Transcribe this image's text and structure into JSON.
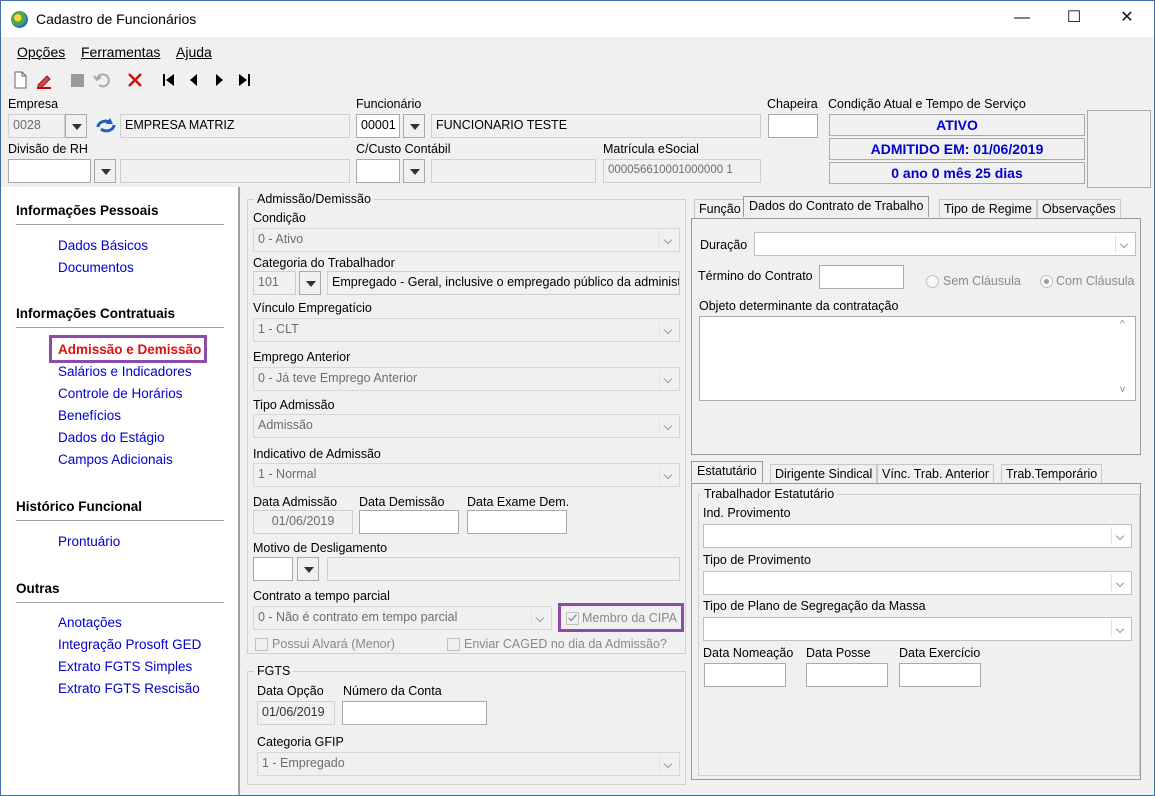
{
  "window": {
    "title": "Cadastro de Funcionários",
    "min": "—",
    "max": "☐",
    "close": "✕"
  },
  "menu": [
    "Opções",
    "Ferramentas",
    "Ajuda"
  ],
  "header": {
    "empresa_label": "Empresa",
    "empresa_code": "0028",
    "empresa_name": "EMPRESA MATRIZ",
    "funcionario_label": "Funcionário",
    "funcionario_code": "00001",
    "funcionario_name": "FUNCIONARIO TESTE",
    "chapeira_label": "Chapeira",
    "chapeira_value": "",
    "condicao_label": "Condição Atual e Tempo de Serviço",
    "status_ativo": "ATIVO",
    "status_admitido": "ADMITIDO EM: 01/06/2019",
    "status_tempo": "0 ano 0 mês 25 dias",
    "divisao_label": "Divisão de RH",
    "ccusto_label": "C/Custo Contábil",
    "matricula_label": "Matrícula eSocial",
    "matricula_value": "000056610001000000 1"
  },
  "sidebar": {
    "sec1": "Informações Pessoais",
    "sec1_items": [
      "Dados Básicos",
      "Documentos"
    ],
    "sec2": "Informações Contratuais",
    "sec2_items": [
      "Admissão e Demissão",
      "Salários e Indicadores",
      "Controle de Horários",
      "Benefícios",
      "Dados do Estágio",
      "Campos Adicionais"
    ],
    "sec3": "Histórico Funcional",
    "sec3_items": [
      "Prontuário"
    ],
    "sec4": "Outras",
    "sec4_items": [
      "Anotações",
      "Integração Prosoft GED",
      "Extrato FGTS Simples",
      "Extrato FGTS Rescisão"
    ]
  },
  "admissao": {
    "group": "Admissão/Demissão",
    "condicao_label": "Condição",
    "condicao_value": "0 - Ativo",
    "categoria_label": "Categoria do Trabalhador",
    "categoria_code": "101",
    "categoria_desc": "Empregado - Geral, inclusive o empregado público da administ",
    "vinculo_label": "Vínculo Empregatício",
    "vinculo_value": "1 - CLT",
    "emprego_label": "Emprego Anterior",
    "emprego_value": "0 - Já teve Emprego Anterior",
    "tipo_label": "Tipo Admissão",
    "tipo_value": "Admissão",
    "indicativo_label": "Indicativo de Admissão",
    "indicativo_value": "1 - Normal",
    "data_adm_label": "Data Admissão",
    "data_adm_value": "01/06/2019",
    "data_dem_label": "Data Demissão",
    "data_exame_label": "Data Exame Dem.",
    "motivo_label": "Motivo de Desligamento",
    "parcial_label": "Contrato a tempo parcial",
    "parcial_value": "0 - Não é contrato em tempo parcial",
    "cipa": "Membro da CIPA",
    "alvara": "Possui Alvará (Menor)",
    "caged": "Enviar CAGED no dia da Admissão?"
  },
  "fgts": {
    "group": "FGTS",
    "data_label": "Data Opção",
    "data_value": "01/06/2019",
    "conta_label": "Número da Conta",
    "gfip_label": "Categoria GFIP",
    "gfip_value": "1 - Empregado"
  },
  "contrato": {
    "tabs": [
      "Função",
      "Dados do Contrato de Trabalho",
      "Tipo de Regime",
      "Observações"
    ],
    "duracao_label": "Duração",
    "termino_label": "Término do Contrato",
    "sem_clausula": "Sem Cláusula",
    "com_clausula": "Com Cláusula",
    "objeto_label": "Objeto determinante da contratação"
  },
  "estatutario": {
    "tabs": [
      "Estatutário",
      "Dirigente Sindical",
      "Vínc. Trab. Anterior",
      "Trab.Temporário"
    ],
    "group": "Trabalhador Estatutário",
    "ind_label": "Ind. Provimento",
    "tipo_label": "Tipo de Provimento",
    "plano_label": "Tipo de Plano de Segregação da Massa",
    "nomeacao_label": "Data Nomeação",
    "posse_label": "Data Posse",
    "exercicio_label": "Data Exercício"
  }
}
